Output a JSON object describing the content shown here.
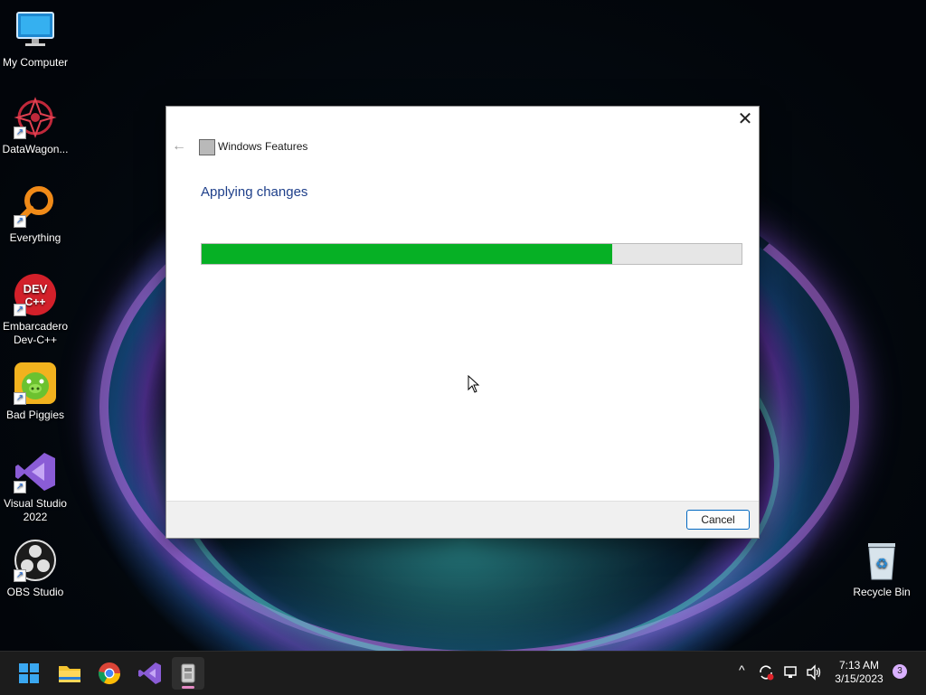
{
  "desktop": {
    "icons": [
      {
        "label": "My Computer"
      },
      {
        "label": "DataWagon..."
      },
      {
        "label": "Everything"
      },
      {
        "label": "Embarcadero Dev-C++"
      },
      {
        "label": "Bad Piggies"
      },
      {
        "label": "Visual Studio 2022"
      },
      {
        "label": "OBS Studio"
      },
      {
        "label": "Recycle Bin"
      }
    ]
  },
  "dialog": {
    "title": "Windows Features",
    "heading": "Applying changes",
    "progress_fraction": 0.76,
    "cancel_label": "Cancel",
    "close_glyph": "✕",
    "back_glyph": "←"
  },
  "taskbar": {
    "apps": [
      "start-icon",
      "file-explorer-icon",
      "chrome-icon",
      "visual-studio-icon",
      "windows-features-icon"
    ],
    "time": "7:13 AM",
    "date": "3/15/2023",
    "notification_count": "3",
    "chevron_glyph": "^"
  },
  "colors": {
    "progress_fill": "#06b025",
    "heading": "#1e3f8a",
    "accent_border": "#0067c0"
  }
}
